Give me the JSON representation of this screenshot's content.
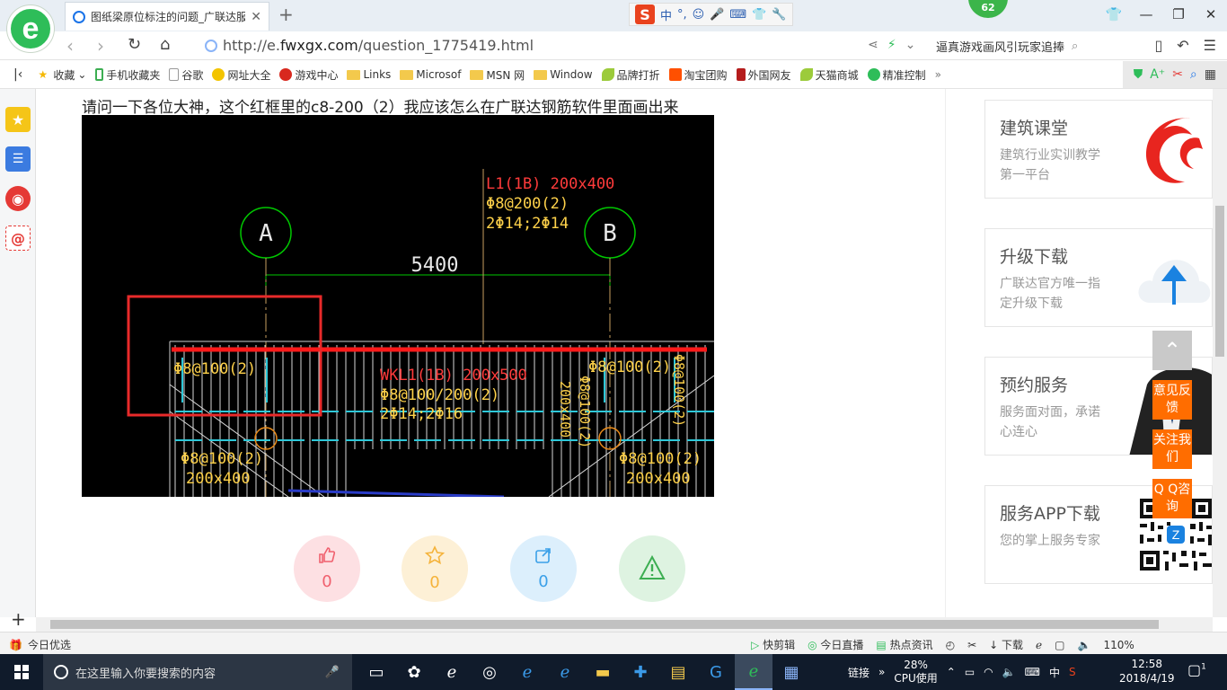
{
  "browser": {
    "tab_title": "图纸梁原位标注的问题_广联达服",
    "url_prefix": "http://e.",
    "url_domain": "fwxgx.com",
    "url_path": "/question_1775419.html",
    "search_text": "逼真游戏画风引玩家追捧",
    "badge_count": "62",
    "zoom": "110%"
  },
  "ime": {
    "logo": "S",
    "items": [
      "中",
      "°,",
      "☺",
      "🎤",
      "⌨",
      "👕",
      "🔧"
    ]
  },
  "bookmarks": [
    {
      "label": "收藏",
      "icon": "star-icon"
    },
    {
      "label": "手机收藏夹",
      "icon": "phone-icon"
    },
    {
      "label": "谷歌",
      "icon": "doc-icon"
    },
    {
      "label": "网址大全",
      "icon": "globe-icon"
    },
    {
      "label": "游戏中心",
      "icon": "game-icon"
    },
    {
      "label": "Links",
      "icon": "folder-icon"
    },
    {
      "label": "Microsof",
      "icon": "folder-icon"
    },
    {
      "label": "MSN 网",
      "icon": "folder-icon"
    },
    {
      "label": "Window",
      "icon": "folder-icon"
    },
    {
      "label": "品牌打折",
      "icon": "leaf-icon"
    },
    {
      "label": "淘宝团购",
      "icon": "taobao-icon"
    },
    {
      "label": "外国网友",
      "icon": "flag-icon"
    },
    {
      "label": "天猫商城",
      "icon": "leaf-icon"
    },
    {
      "label": "精准控制",
      "icon": "chat-icon"
    }
  ],
  "question": {
    "text": "请问一下各位大神，这个红框里的c8-200（2）我应该怎么在广联达钢筋软件里面画出来"
  },
  "drawing": {
    "axis_a": "A",
    "axis_b": "B",
    "span": "5400",
    "l1_title": "L1(1B) 200x400",
    "l1_stirrup": "Φ8@200(2)",
    "l1_bars": "2Φ14;2Φ14",
    "wkl_title": "WKL1(1B) 200x500",
    "wkl_stirrup": "Φ8@100/200(2)",
    "wkl_bars": "2Φ14;2Φ16",
    "left_stirrup": "Φ8@100(2)",
    "right_stirrup": "Φ8@100(2)",
    "vertical_size": "200x400",
    "vertical_stirrup": "Φ8@100(2)",
    "right_vertical": "Φ8@100(2)",
    "bottom_left_stirrup": "Φ8@100(2)",
    "bottom_left_size": "200x400",
    "bottom_right_stirrup": "Φ8@100(2)",
    "bottom_right_size": "200x400"
  },
  "actions": [
    {
      "name": "like",
      "count": "0",
      "icon": "thumbs-up-icon",
      "bg": "#fde0e3",
      "color": "#f0606e"
    },
    {
      "name": "favorite",
      "count": "0",
      "icon": "star-icon",
      "bg": "#fdf0d6",
      "color": "#f5b33b"
    },
    {
      "name": "share",
      "count": "0",
      "icon": "share-icon",
      "bg": "#dceffc",
      "color": "#3ba0e8"
    },
    {
      "name": "report",
      "count": "",
      "icon": "warning-icon",
      "bg": "#def3e1",
      "color": "#3cae52"
    }
  ],
  "cards": [
    {
      "title": "建筑课堂",
      "desc": "建筑行业实训教学第一平台",
      "icon": "swirl-logo-icon"
    },
    {
      "title": "升级下载",
      "desc": "广联达官方唯一指定升级下载",
      "icon": "cloud-upload-icon"
    },
    {
      "title": "预约服务",
      "desc": "服务面对面，承诺心连心",
      "icon": "service-person-icon"
    },
    {
      "title": "服务APP下载",
      "desc": "您的掌上服务专家",
      "icon": "qr-code-icon"
    }
  ],
  "float_buttons": [
    "意见反馈",
    "关注我们",
    "Q Q咨询"
  ],
  "status": {
    "left": "今日优选",
    "items": [
      "快剪辑",
      "今日直播",
      "热点资讯",
      "下载"
    ]
  },
  "taskbar": {
    "search_placeholder": "在这里输入你要搜索的内容",
    "link_label": "链接",
    "cpu_value": "28%",
    "cpu_label": "CPU使用",
    "ime": "中",
    "time": "12:58",
    "date": "2018/4/19",
    "notif_count": "1"
  }
}
